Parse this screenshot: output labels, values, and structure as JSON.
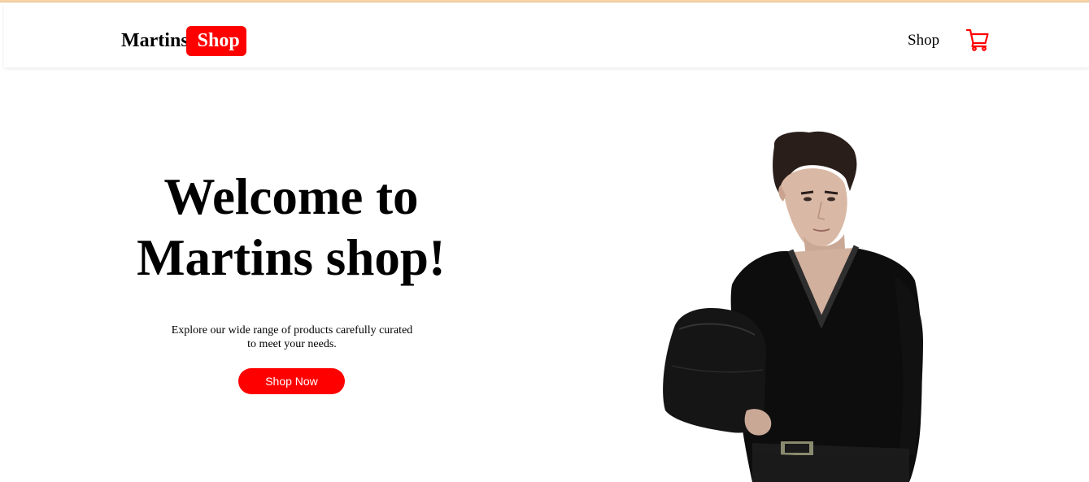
{
  "header": {
    "brand_first": "Martins",
    "brand_second": "Shop",
    "nav_shop": "Shop",
    "cart_icon": "cart-icon"
  },
  "hero": {
    "title_line1": "Welcome to",
    "title_line2": "Martins shop!",
    "description_line1": "Explore our wide range of products carefully curated",
    "description_line2": "to meet your needs.",
    "cta_label": "Shop Now"
  },
  "colors": {
    "accent": "#ff0000",
    "background": "#ffffff",
    "text": "#000000"
  }
}
